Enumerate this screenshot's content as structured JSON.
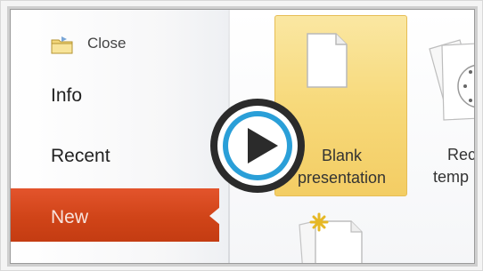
{
  "menu": {
    "close_label": "Close",
    "info_label": "Info",
    "recent_label": "Recent",
    "new_label": "New",
    "active_item": "New"
  },
  "templates": {
    "blank_line1": "Blank",
    "blank_line2": "presentation",
    "recent_line1": "Rec",
    "recent_line2": "temp"
  },
  "icons": {
    "close": "folder-icon",
    "blank": "document-icon",
    "recent": "templates-stack-icon",
    "play": "play-icon"
  },
  "colors": {
    "accent_new": "#d04418",
    "tile_highlight": "#f7d97a",
    "play_blue": "#2a9fd8",
    "play_dark": "#2b2b2b"
  }
}
